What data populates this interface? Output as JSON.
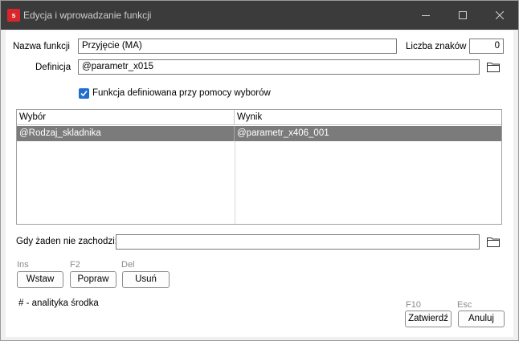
{
  "window": {
    "title": "Edycja i wprowadzanie funkcji",
    "app_icon_letter": "s"
  },
  "form": {
    "nazwa_label": "Nazwa funkcji",
    "nazwa_value": "Przyjęcie (MA)",
    "liczba_label": "Liczba znaków",
    "liczba_value": "0",
    "definicja_label": "Definicja",
    "definicja_value": "@parametr_x015",
    "checkbox_label": "Funkcja definiowana przy pomocy wyborów",
    "checkbox_checked": true
  },
  "table": {
    "headers": [
      "Wybór",
      "Wynik"
    ],
    "rows": [
      [
        "@Rodzaj_skladnika",
        "@parametr_x406_001"
      ]
    ]
  },
  "fallback": {
    "label": "Gdy żaden nie zachodzi:",
    "value": ""
  },
  "actions": {
    "insert_hotkey": "Ins",
    "insert_label": "Wstaw",
    "edit_hotkey": "F2",
    "edit_label": "Popraw",
    "delete_hotkey": "Del",
    "delete_label": "Usuń"
  },
  "note": "# - analityka środka",
  "footer": {
    "confirm_hotkey": "F10",
    "confirm_label": "Zatwierdź",
    "cancel_hotkey": "Esc",
    "cancel_label": "Anuluj"
  },
  "icons": {
    "app": "app-logo-icon",
    "minimize": "minimize-icon",
    "maximize": "maximize-icon",
    "close": "close-icon",
    "folder": "folder-icon",
    "check": "check-icon"
  },
  "colors": {
    "titlebar": "#3b3b3b",
    "app_icon": "#d9262b",
    "checkbox": "#1f6fd1",
    "selected_row": "#7b7b7b"
  }
}
